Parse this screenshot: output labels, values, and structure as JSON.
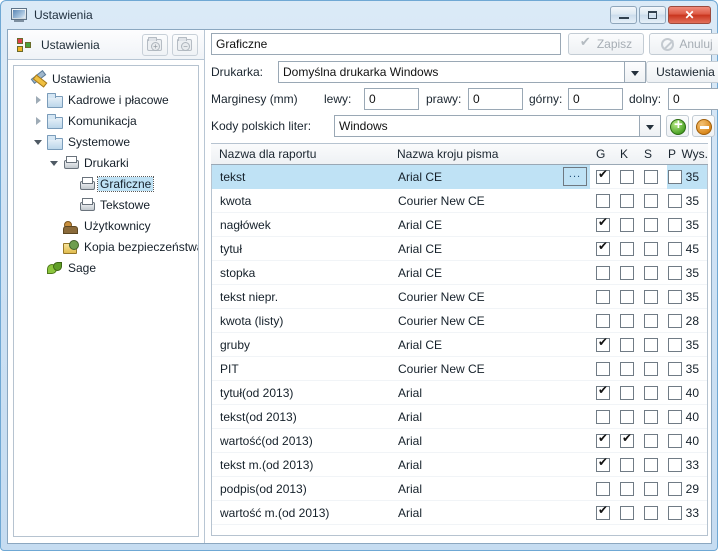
{
  "window": {
    "title": "Ustawienia",
    "icon": "settings-window-icon",
    "buttons": {
      "minimize": "–",
      "maximize": "□",
      "close": "✕"
    }
  },
  "left_panel": {
    "header_label": "Ustawienia",
    "header_icon": "settings-nodes-icon",
    "toolbar": [
      {
        "name": "add-folder-button",
        "icon": "folder-add-icon",
        "badge": "+"
      },
      {
        "name": "delete-folder-button",
        "icon": "folder-remove-icon",
        "badge": "−"
      }
    ],
    "tree": [
      {
        "label": "Ustawienia",
        "icon": "wrench-icon",
        "indent": 0,
        "expander": "none",
        "selected": false
      },
      {
        "label": "Kadrowe i płacowe",
        "icon": "folder-icon",
        "indent": 1,
        "expander": "closed",
        "selected": false
      },
      {
        "label": "Komunikacja",
        "icon": "folder-icon",
        "indent": 1,
        "expander": "closed",
        "selected": false
      },
      {
        "label": "Systemowe",
        "icon": "folder-icon",
        "indent": 1,
        "expander": "open",
        "selected": false
      },
      {
        "label": "Drukarki",
        "icon": "printer-icon",
        "indent": 2,
        "expander": "open",
        "selected": false
      },
      {
        "label": "Graficzne",
        "icon": "printer-icon",
        "indent": 3,
        "expander": "none",
        "selected": true
      },
      {
        "label": "Tekstowe",
        "icon": "printer-icon",
        "indent": 3,
        "expander": "none",
        "selected": false
      },
      {
        "label": "Użytkownicy",
        "icon": "users-icon",
        "indent": 2,
        "expander": "none",
        "selected": false
      },
      {
        "label": "Kopia bezpieczeństwa",
        "icon": "backup-icon",
        "indent": 2,
        "expander": "none",
        "selected": false
      },
      {
        "label": "Sage",
        "icon": "sage-icon",
        "indent": 1,
        "expander": "none",
        "selected": false
      }
    ]
  },
  "form": {
    "name_value": "Graficzne",
    "name_placeholder": "",
    "save_label": "Zapisz",
    "cancel_label": "Anuluj",
    "save_enabled": false,
    "cancel_enabled": false,
    "printer_label": "Drukarka:",
    "printer_value": "Domyślna drukarka Windows",
    "printer_settings_label": "Ustawienia",
    "margins_label": "Marginesy (mm)",
    "margin_left_label": "lewy:",
    "margin_left_value": "0",
    "margin_right_label": "prawy:",
    "margin_right_value": "0",
    "margin_top_label": "górny:",
    "margin_top_value": "0",
    "margin_bottom_label": "dolny:",
    "margin_bottom_value": "0",
    "codes_label": "Kody polskich liter:",
    "codes_value": "Windows",
    "add_button": "add-row-button",
    "remove_button": "remove-row-button"
  },
  "grid": {
    "columns": [
      {
        "key": "name",
        "label": "Nazwa dla raportu"
      },
      {
        "key": "font",
        "label": "Nazwa kroju pisma"
      },
      {
        "key": "g",
        "label": "G"
      },
      {
        "key": "k",
        "label": "K"
      },
      {
        "key": "s",
        "label": "S"
      },
      {
        "key": "p",
        "label": "P"
      },
      {
        "key": "wys",
        "label": "Wys."
      }
    ],
    "ellipsis_label": "...",
    "rows": [
      {
        "name": "tekst",
        "font": "Arial CE",
        "g": true,
        "k": false,
        "s": false,
        "p": false,
        "wys": "35",
        "selected": true
      },
      {
        "name": "kwota",
        "font": "Courier New CE",
        "g": false,
        "k": false,
        "s": false,
        "p": false,
        "wys": "35",
        "selected": false
      },
      {
        "name": "nagłówek",
        "font": "Arial CE",
        "g": true,
        "k": false,
        "s": false,
        "p": false,
        "wys": "35",
        "selected": false
      },
      {
        "name": "tytuł",
        "font": "Arial CE",
        "g": true,
        "k": false,
        "s": false,
        "p": false,
        "wys": "45",
        "selected": false
      },
      {
        "name": "stopka",
        "font": "Arial CE",
        "g": false,
        "k": false,
        "s": false,
        "p": false,
        "wys": "35",
        "selected": false
      },
      {
        "name": "tekst niepr.",
        "font": "Courier New CE",
        "g": false,
        "k": false,
        "s": false,
        "p": false,
        "wys": "35",
        "selected": false
      },
      {
        "name": "kwota (listy)",
        "font": "Courier New CE",
        "g": false,
        "k": false,
        "s": false,
        "p": false,
        "wys": "28",
        "selected": false
      },
      {
        "name": "gruby",
        "font": "Arial CE",
        "g": true,
        "k": false,
        "s": false,
        "p": false,
        "wys": "35",
        "selected": false
      },
      {
        "name": "PIT",
        "font": "Courier New CE",
        "g": false,
        "k": false,
        "s": false,
        "p": false,
        "wys": "35",
        "selected": false
      },
      {
        "name": "tytuł(od 2013)",
        "font": "Arial",
        "g": true,
        "k": false,
        "s": false,
        "p": false,
        "wys": "40",
        "selected": false
      },
      {
        "name": "tekst(od 2013)",
        "font": "Arial",
        "g": false,
        "k": false,
        "s": false,
        "p": false,
        "wys": "40",
        "selected": false
      },
      {
        "name": "wartość(od 2013)",
        "font": "Arial",
        "g": true,
        "k": true,
        "s": false,
        "p": false,
        "wys": "40",
        "selected": false
      },
      {
        "name": "tekst m.(od 2013)",
        "font": "Arial",
        "g": true,
        "k": false,
        "s": false,
        "p": false,
        "wys": "33",
        "selected": false
      },
      {
        "name": "podpis(od 2013)",
        "font": "Arial",
        "g": false,
        "k": false,
        "s": false,
        "p": false,
        "wys": "29",
        "selected": false
      },
      {
        "name": "wartość m.(od 2013)",
        "font": "Arial",
        "g": true,
        "k": false,
        "s": false,
        "p": false,
        "wys": "33",
        "selected": false
      }
    ]
  },
  "colors": {
    "selection": "#bfe2f5",
    "frame": "#c5dcf1",
    "close_button": "#c9341d",
    "add_button": "#4fa52a",
    "remove_button": "#db8a1e"
  }
}
